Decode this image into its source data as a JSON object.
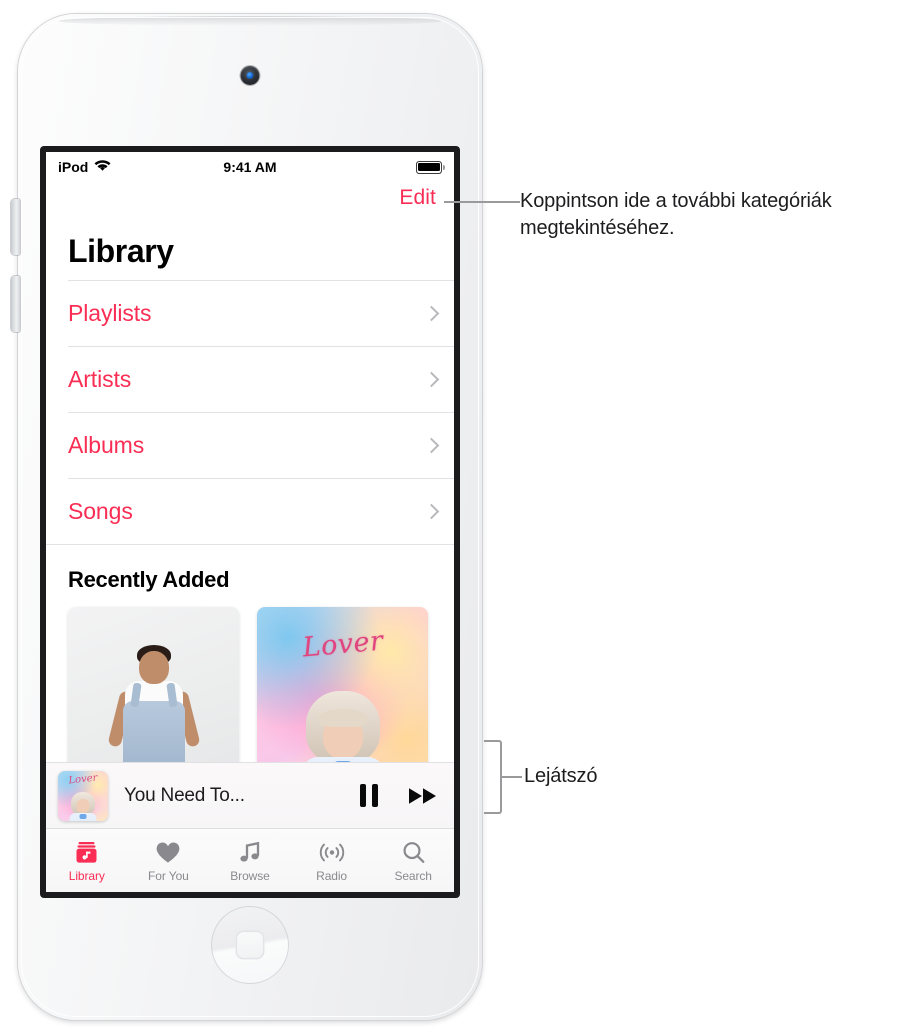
{
  "device": {
    "name": "iPod touch",
    "camera_icon": "front-camera",
    "home_button_icon": "home-button",
    "volume_up_icon": "volume-up-button",
    "volume_down_icon": "volume-down-button"
  },
  "status_bar": {
    "carrier": "iPod",
    "wifi_icon": "wifi-icon",
    "time": "9:41 AM",
    "battery_icon": "battery-full-icon"
  },
  "screen": {
    "edit_label": "Edit",
    "title": "Library",
    "categories": [
      {
        "label": "Playlists",
        "chevron_icon": "chevron-right-icon"
      },
      {
        "label": "Artists",
        "chevron_icon": "chevron-right-icon"
      },
      {
        "label": "Albums",
        "chevron_icon": "chevron-right-icon"
      },
      {
        "label": "Songs",
        "chevron_icon": "chevron-right-icon"
      }
    ],
    "recently_added": {
      "heading": "Recently Added",
      "albums": [
        {
          "name": "album-artwork-person-overalls",
          "title": ""
        },
        {
          "name": "album-artwork-lover",
          "title": "Lover"
        }
      ]
    },
    "mini_player": {
      "artwork_name": "lover-album-thumbnail",
      "artwork_title": "Lover",
      "track_title": "You Need To...",
      "pause_icon": "pause-icon",
      "forward_icon": "fast-forward-icon"
    },
    "tabs": [
      {
        "label": "Library",
        "icon": "library-icon",
        "active": true
      },
      {
        "label": "For You",
        "icon": "heart-icon",
        "active": false
      },
      {
        "label": "Browse",
        "icon": "music-note-icon",
        "active": false
      },
      {
        "label": "Radio",
        "icon": "radio-waves-icon",
        "active": false
      },
      {
        "label": "Search",
        "icon": "search-icon",
        "active": false
      }
    ]
  },
  "callouts": {
    "edit": "Koppintson ide a további kategóriák megtekintéséhez.",
    "player": "Lejátszó"
  },
  "colors": {
    "accent": "#fa2d54",
    "text": "#1d1d1f",
    "muted": "#8a8a8e",
    "separator": "#e2e2e4",
    "leader": "#9a9a9c"
  }
}
